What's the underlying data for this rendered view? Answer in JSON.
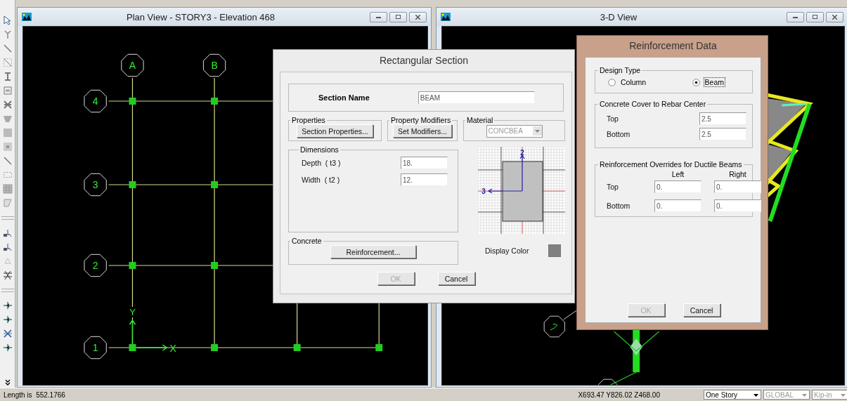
{
  "plan_view": {
    "title": "Plan View - STORY3 - Elevation 468",
    "grid_x": [
      {
        "label": "A"
      },
      {
        "label": "B"
      }
    ],
    "grid_y": [
      {
        "label": "4"
      },
      {
        "label": "3"
      },
      {
        "label": "2"
      },
      {
        "label": "1"
      }
    ],
    "axis_labels": [
      "X",
      "Y"
    ]
  },
  "view_3d": {
    "title": "3-D View"
  },
  "rectangular_section": {
    "title": "Rectangular Section",
    "section_name_label": "Section Name",
    "section_name": "BEAM",
    "properties": {
      "legend": "Properties",
      "button": "Section Properties..."
    },
    "property_modifiers": {
      "legend": "Property Modifiers",
      "button": "Set Modifiers..."
    },
    "material": {
      "legend": "Material",
      "value": "CONCBEA",
      "disabled": true
    },
    "dimensions": {
      "legend": "Dimensions",
      "fields": [
        {
          "label": "Depth  ( t3 )",
          "value": "18."
        },
        {
          "label": "Width  ( t2 )",
          "value": "12."
        }
      ]
    },
    "concrete": {
      "legend": "Concrete",
      "button": "Reinforcement..."
    },
    "preview_axes": [
      "2",
      "3"
    ],
    "display_color_label": "Display Color",
    "buttons": [
      {
        "label": "OK",
        "disabled": true
      },
      {
        "label": "Cancel",
        "disabled": false
      }
    ]
  },
  "reinforcement_data": {
    "title": "Reinforcement Data",
    "design_type": {
      "legend": "Design Type",
      "options": [
        {
          "label": "Column",
          "selected": false,
          "focused": false
        },
        {
          "label": "Beam",
          "selected": true,
          "focused": true
        }
      ]
    },
    "cover": {
      "legend": "Concrete Cover to Rebar Center",
      "fields": [
        {
          "label": "Top",
          "value": "2.5"
        },
        {
          "label": "Bottom",
          "value": "2.5"
        }
      ]
    },
    "overrides": {
      "legend": "Reinforcement Overrides for Ductile Beams",
      "columns": [
        "Left",
        "Right"
      ],
      "rows": [
        {
          "label": "Top",
          "values": [
            "0.",
            "0."
          ]
        },
        {
          "label": "Bottom",
          "values": [
            "0.",
            "0."
          ]
        }
      ]
    },
    "buttons": [
      {
        "label": "OK",
        "disabled": true
      },
      {
        "label": "Cancel",
        "disabled": false
      }
    ]
  },
  "status_bar": {
    "message": "Length is  552.1766",
    "coordinates": "X693.47 Y826.02 Z468.00",
    "dropdowns": [
      {
        "value": "One Story",
        "disabled": false
      },
      {
        "value": "GLOBAL",
        "disabled": true
      },
      {
        "value": "Kip-in",
        "disabled": true
      }
    ]
  }
}
